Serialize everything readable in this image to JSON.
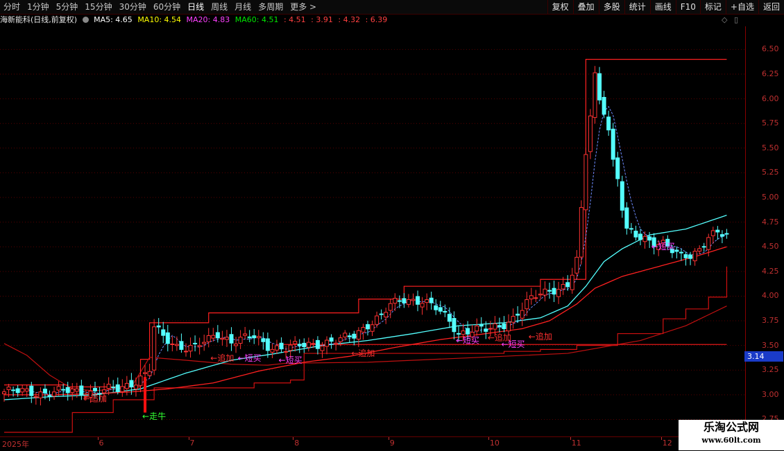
{
  "toolbar": {
    "tabs": [
      "分时",
      "1分钟",
      "5分钟",
      "15分钟",
      "30分钟",
      "60分钟",
      "日线",
      "周线",
      "月线",
      "多周期",
      "更多 >"
    ],
    "active_tab": "日线",
    "right_buttons": [
      "复权",
      "叠加",
      "多股",
      "统计",
      "画线",
      "F10",
      "标记",
      "+自选",
      "返回"
    ]
  },
  "info": {
    "stock_name": "海新能科(日线,前复权)",
    "ma5": "MA5: 4.65",
    "ma10": "MA10: 4.54",
    "ma20": "MA20: 4.83",
    "ma60": "MA60: 4.51",
    "extra": [
      ": 4.51",
      ": 3.91",
      ": 4.32",
      ": 6.39"
    ]
  },
  "colors": {
    "up": "#ff3232",
    "down": "#54ffff",
    "ma5": "#ffffff",
    "ma10": "#ffff00",
    "ma20": "#ff40ff",
    "ma60": "#00e600",
    "extra": "#ff4040",
    "grid": "#5a0000"
  },
  "y_axis": [
    "6.50",
    "6.25",
    "6.00",
    "5.75",
    "5.50",
    "5.25",
    "5.00",
    "4.75",
    "4.50",
    "4.25",
    "4.00",
    "3.75",
    "3.50",
    "3.25",
    "3.00",
    "2.75"
  ],
  "current_price": "3.14",
  "x_axis": [
    {
      "label": "2025年",
      "day": 0
    },
    {
      "label": "6",
      "day": 21
    },
    {
      "label": "7",
      "day": 41
    },
    {
      "label": "8",
      "day": 64
    },
    {
      "label": "9",
      "day": 85
    },
    {
      "label": "10",
      "day": 107
    },
    {
      "label": "11",
      "day": 125
    },
    {
      "label": "12",
      "day": 145
    }
  ],
  "annotations": [
    {
      "text": "←追加",
      "day": 18,
      "price": 2.96,
      "color": "#ff3030"
    },
    {
      "text": "←走牛",
      "day": 31,
      "price": 2.78,
      "color": "#33ff33"
    },
    {
      "text": "←追加",
      "day": 46,
      "price": 3.37,
      "color": "#ff3030"
    },
    {
      "text": "←短买",
      "day": 52,
      "price": 3.37,
      "color": "#ff40ff"
    },
    {
      "text": "←短买",
      "day": 61,
      "price": 3.35,
      "color": "#ff40ff"
    },
    {
      "text": "←追加",
      "day": 77,
      "price": 3.42,
      "color": "#ff3030"
    },
    {
      "text": "←短买",
      "day": 100,
      "price": 3.55,
      "color": "#ff40ff"
    },
    {
      "text": "←追加",
      "day": 107,
      "price": 3.58,
      "color": "#ff3030"
    },
    {
      "text": "←短买",
      "day": 110,
      "price": 3.51,
      "color": "#ff40ff"
    },
    {
      "text": "←追加",
      "day": 116,
      "price": 3.59,
      "color": "#ff3030"
    },
    {
      "text": "←短买",
      "day": 143,
      "price": 4.5,
      "color": "#ff40ff"
    }
  ],
  "watermark": {
    "title": "乐淘公式网",
    "url": "www.60lt.com"
  },
  "chart_data": {
    "type": "candlestick",
    "title": "海新能科(日线,前复权)",
    "ylim": [
      2.62,
      6.65
    ],
    "start_label": "2025年",
    "month_starts": {
      "6": 21,
      "7": 41,
      "8": 64,
      "9": 85,
      "10": 107,
      "11": 125,
      "12": 145
    },
    "close_keypoints": [
      [
        0,
        3.03
      ],
      [
        5,
        3.03
      ],
      [
        10,
        3.02
      ],
      [
        15,
        3.04
      ],
      [
        20,
        3.03
      ],
      [
        25,
        3.06
      ],
      [
        28,
        3.12
      ],
      [
        30,
        3.18
      ],
      [
        31,
        3.2
      ],
      [
        32,
        3.25
      ],
      [
        33,
        3.68
      ],
      [
        35,
        3.58
      ],
      [
        38,
        3.5
      ],
      [
        42,
        3.48
      ],
      [
        45,
        3.55
      ],
      [
        47,
        3.62
      ],
      [
        50,
        3.55
      ],
      [
        55,
        3.58
      ],
      [
        58,
        3.5
      ],
      [
        62,
        3.47
      ],
      [
        66,
        3.5
      ],
      [
        70,
        3.53
      ],
      [
        74,
        3.55
      ],
      [
        77,
        3.6
      ],
      [
        80,
        3.72
      ],
      [
        83,
        3.8
      ],
      [
        85,
        3.9
      ],
      [
        88,
        3.97
      ],
      [
        92,
        3.96
      ],
      [
        95,
        3.87
      ],
      [
        98,
        3.75
      ],
      [
        100,
        3.63
      ],
      [
        103,
        3.66
      ],
      [
        106,
        3.65
      ],
      [
        109,
        3.7
      ],
      [
        112,
        3.78
      ],
      [
        115,
        3.92
      ],
      [
        118,
        4.03
      ],
      [
        121,
        4.08
      ],
      [
        124,
        4.1
      ],
      [
        126,
        4.35
      ],
      [
        127,
        4.85
      ],
      [
        128,
        5.45
      ],
      [
        129,
        5.85
      ],
      [
        130,
        6.25
      ],
      [
        131,
        6.0
      ],
      [
        132,
        5.9
      ],
      [
        133,
        5.7
      ],
      [
        134,
        5.35
      ],
      [
        135,
        5.18
      ],
      [
        136,
        4.88
      ],
      [
        137,
        4.65
      ],
      [
        139,
        4.62
      ],
      [
        141,
        4.6
      ],
      [
        143,
        4.55
      ],
      [
        145,
        4.52
      ],
      [
        147,
        4.45
      ],
      [
        149,
        4.4
      ],
      [
        151,
        4.43
      ],
      [
        153,
        4.48
      ],
      [
        155,
        4.6
      ],
      [
        157,
        4.62
      ],
      [
        159,
        4.62
      ]
    ],
    "ma_a_keypoints": [
      [
        0,
        2.95
      ],
      [
        10,
        2.98
      ],
      [
        20,
        3.0
      ],
      [
        30,
        3.06
      ],
      [
        40,
        3.22
      ],
      [
        50,
        3.35
      ],
      [
        60,
        3.42
      ],
      [
        70,
        3.5
      ],
      [
        80,
        3.55
      ],
      [
        90,
        3.62
      ],
      [
        100,
        3.7
      ],
      [
        110,
        3.73
      ],
      [
        118,
        3.78
      ],
      [
        124,
        3.9
      ],
      [
        128,
        4.1
      ],
      [
        132,
        4.35
      ],
      [
        136,
        4.48
      ],
      [
        142,
        4.62
      ],
      [
        150,
        4.68
      ],
      [
        159,
        4.82
      ]
    ],
    "ma_b_keypoints": [
      [
        0,
        3.0
      ],
      [
        10,
        3.0
      ],
      [
        20,
        3.01
      ],
      [
        28,
        3.03
      ],
      [
        36,
        3.06
      ],
      [
        46,
        3.12
      ],
      [
        56,
        3.24
      ],
      [
        66,
        3.33
      ],
      [
        76,
        3.39
      ],
      [
        86,
        3.48
      ],
      [
        96,
        3.56
      ],
      [
        106,
        3.62
      ],
      [
        114,
        3.67
      ],
      [
        120,
        3.75
      ],
      [
        126,
        3.92
      ],
      [
        130,
        4.08
      ],
      [
        136,
        4.2
      ],
      [
        144,
        4.3
      ],
      [
        152,
        4.4
      ],
      [
        159,
        4.5
      ]
    ],
    "stop_line_keypoints": [
      [
        0,
        2.62
      ],
      [
        13,
        2.62
      ],
      [
        15,
        2.82
      ],
      [
        23,
        2.82
      ],
      [
        24,
        2.95
      ],
      [
        30,
        2.95
      ],
      [
        33,
        3.07
      ],
      [
        55,
        3.12
      ],
      [
        63,
        3.15
      ],
      [
        66,
        3.42
      ],
      [
        110,
        3.44
      ],
      [
        118,
        3.46
      ],
      [
        126,
        3.5
      ],
      [
        135,
        3.62
      ],
      [
        145,
        3.77
      ],
      [
        150,
        3.87
      ],
      [
        155,
        3.99
      ],
      [
        159,
        4.3
      ]
    ],
    "channel_low_keypoints": [
      [
        0,
        3.52
      ],
      [
        5,
        3.4
      ],
      [
        10,
        3.2
      ],
      [
        15,
        3.06
      ],
      [
        20,
        3.04
      ],
      [
        28,
        3.08
      ],
      [
        32,
        3.38
      ],
      [
        40,
        3.35
      ],
      [
        50,
        3.31
      ],
      [
        58,
        3.3
      ],
      [
        62,
        3.32
      ],
      [
        80,
        3.33
      ],
      [
        100,
        3.37
      ],
      [
        124,
        3.42
      ],
      [
        140,
        3.55
      ],
      [
        150,
        3.7
      ],
      [
        159,
        3.9
      ]
    ],
    "box_top_keypoints": [
      [
        0,
        3.1
      ],
      [
        12,
        3.1
      ],
      [
        14,
        3.08
      ],
      [
        28,
        3.08
      ],
      [
        30,
        3.36
      ],
      [
        32,
        3.73
      ],
      [
        44,
        3.73
      ],
      [
        45,
        3.83
      ],
      [
        76,
        3.83
      ],
      [
        78,
        3.97
      ],
      [
        87,
        3.97
      ],
      [
        88,
        4.1
      ],
      [
        114,
        4.1
      ],
      [
        118,
        4.17
      ],
      [
        126,
        4.17
      ],
      [
        128,
        6.4
      ],
      [
        159,
        6.4
      ]
    ],
    "flat_line": {
      "price": 3.51,
      "from_day": 60,
      "to_day": 159
    }
  }
}
